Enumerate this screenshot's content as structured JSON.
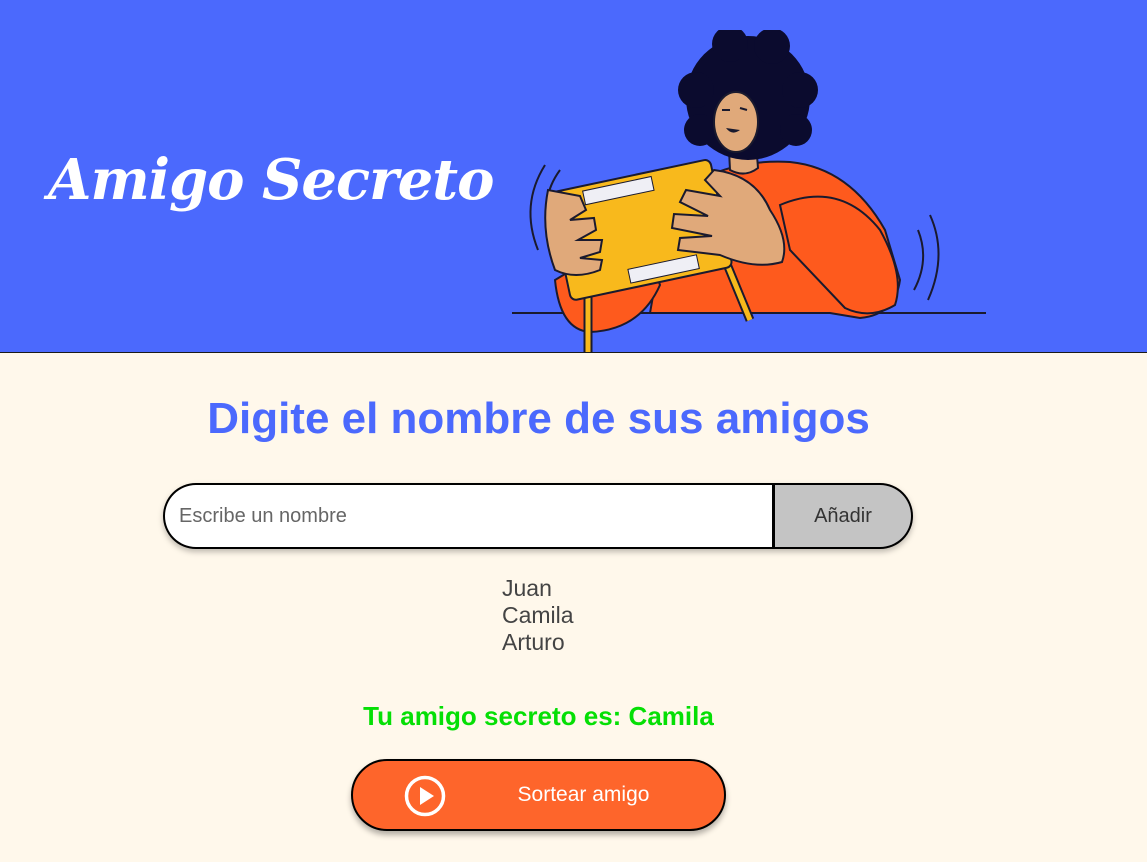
{
  "header": {
    "title": "Amigo Secreto"
  },
  "main": {
    "section_title": "Digite el nombre de sus amigos",
    "input": {
      "placeholder": "Escribe un nombre",
      "value": ""
    },
    "add_button_label": "Añadir",
    "friends": [
      "Juan",
      "Camila",
      "Arturo"
    ],
    "result_text": "Tu amigo secreto es: Camila",
    "draw_button_label": "Sortear amigo"
  },
  "icons": {
    "draw_button_icon": "play-circle-icon"
  },
  "colors": {
    "header_background": "#4B69FD",
    "page_background": "#FFF8EB",
    "title_blue": "#4B69FD",
    "add_button_background": "#C4C4C4",
    "result_green": "#05DF05",
    "draw_button_background": "#FE652B"
  }
}
